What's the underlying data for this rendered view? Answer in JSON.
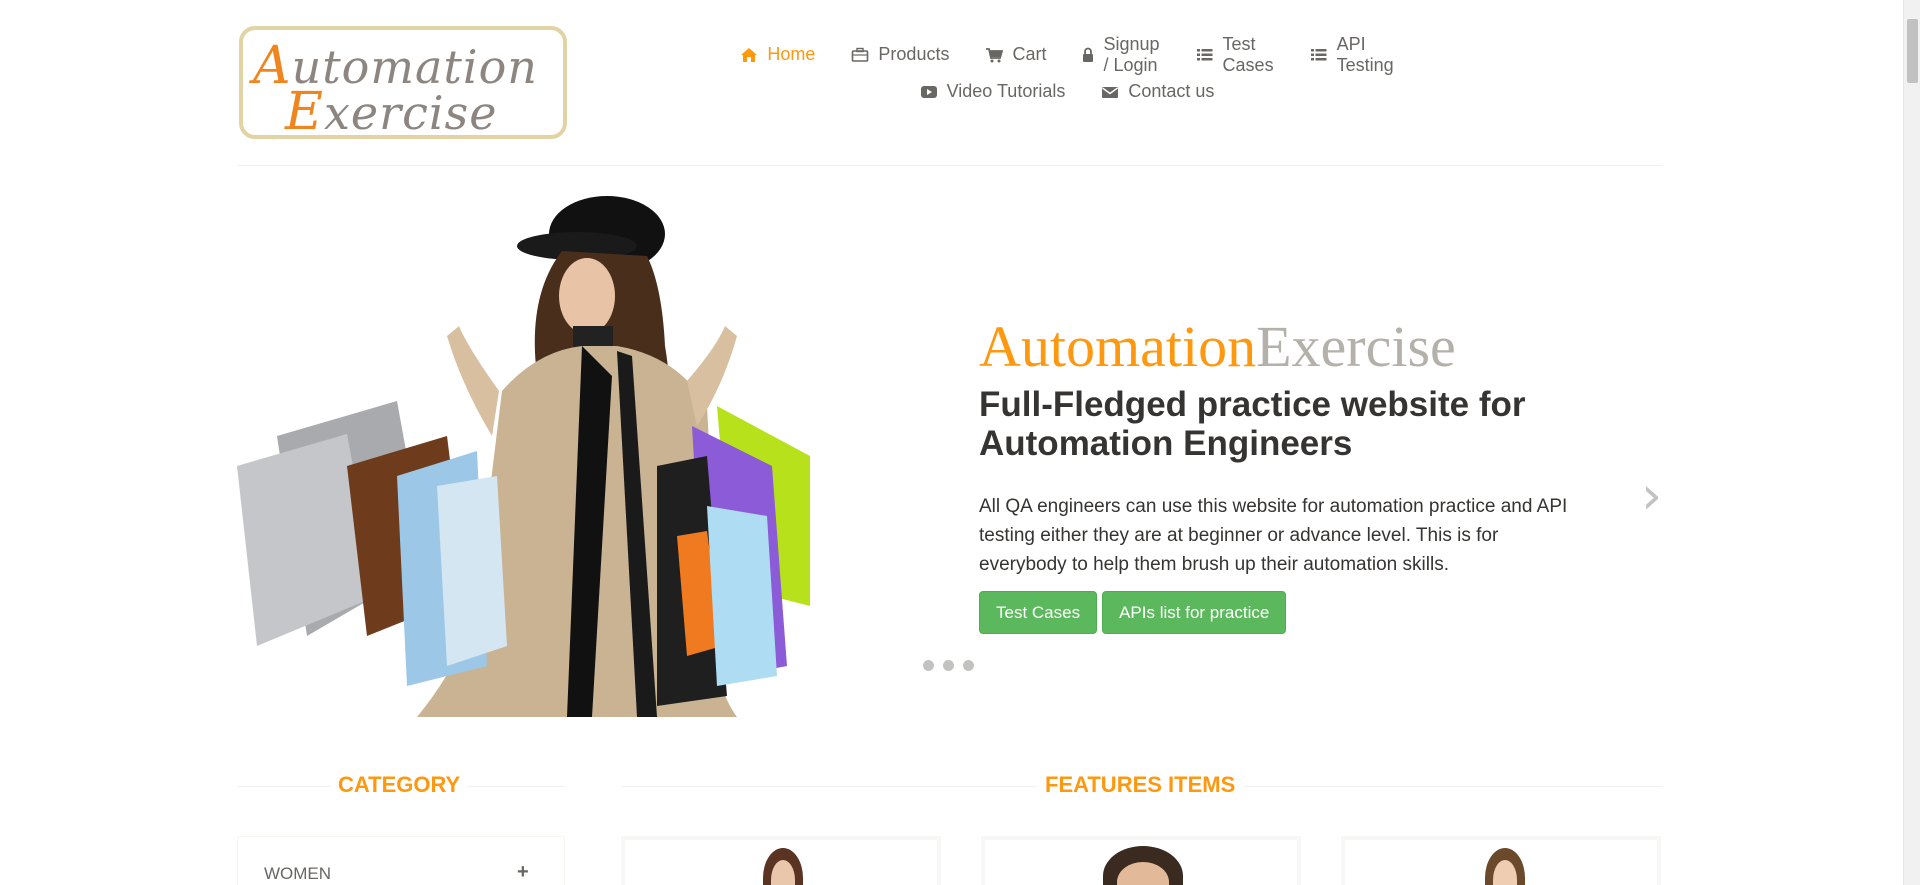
{
  "logo": {
    "line1_cap": "A",
    "line1_rest": "utomation",
    "line2_cap": "E",
    "line2_rest": "xercise"
  },
  "nav": {
    "row1": [
      {
        "label": "Home",
        "icon": "home-icon",
        "active": true
      },
      {
        "label": "Products",
        "icon": "briefcase-icon"
      },
      {
        "label": "Cart",
        "icon": "cart-icon"
      },
      {
        "label": "Signup / Login",
        "icon": "lock-icon"
      },
      {
        "label": "Test Cases",
        "icon": "list-icon"
      },
      {
        "label": "API Testing",
        "icon": "list-icon"
      }
    ],
    "row2": [
      {
        "label": "Video Tutorials",
        "icon": "youtube-play-icon"
      },
      {
        "label": "Contact us",
        "icon": "envelope-icon"
      }
    ]
  },
  "slider": {
    "title_part1": "Automation",
    "title_part2": "Exercise",
    "subtitle": "Full-Fledged practice website for Automation Engineers",
    "description": "All QA engineers can use this website for automation practice and API testing either they are at beginner or advance level. This is for everybody to help them brush up their automation skills.",
    "btn_test_cases": "Test Cases",
    "btn_apis": "APIs list for practice",
    "prev_arrow": "‹",
    "next_arrow": "›"
  },
  "sections": {
    "category": "CATEGORY",
    "features": "FEATURES ITEMS"
  },
  "category": {
    "first_item": "WOMEN",
    "expand_symbol": "+"
  },
  "colors": {
    "accent": "#fe980f",
    "button": "#5cb85c",
    "text": "#696763"
  }
}
